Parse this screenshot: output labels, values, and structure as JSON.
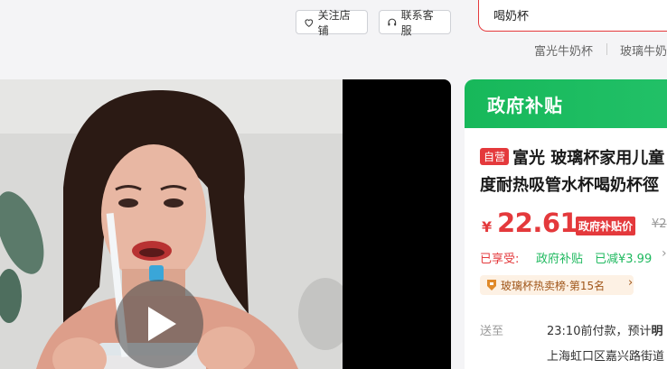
{
  "header": {
    "follow_label": "关注店铺",
    "service_label": "联系客服",
    "search_value": "喝奶杯",
    "hot_searches": [
      "富光牛奶杯",
      "玻璃牛奶"
    ]
  },
  "gallery": {
    "play_icon": "play-icon"
  },
  "product": {
    "banner": "政府补贴",
    "self_op_badge": "自营",
    "title_line1": "富光 玻璃杯家用儿童",
    "title_line2": "度耐热吸管水杯喝奶杯徑",
    "price_symbol": "¥",
    "price": "22.61",
    "price_tag": "政府补贴价",
    "original_price": "¥2",
    "enjoyed_label": "已享受:",
    "subsidy_text": "政府补贴",
    "reduced_text": "已减¥3.99",
    "rank_text": "玻璃杯热卖榜·第15名",
    "delivery_label": "送至",
    "delivery_time_prefix": "23:10前付款，预计",
    "delivery_time_bold": "明",
    "address": "上海虹口区嘉兴路街道"
  },
  "colors": {
    "accent_red": "#e4393c",
    "gov_green": "#1fb95f"
  }
}
